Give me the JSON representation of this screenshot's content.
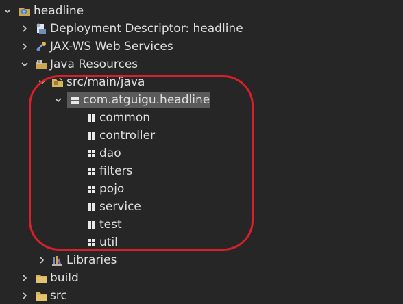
{
  "tree": {
    "root": {
      "label": "headline",
      "icon": "project-icon"
    },
    "items": [
      {
        "label": "Deployment Descriptor: headline",
        "icon": "deployment-descriptor-icon"
      },
      {
        "label": "JAX-WS Web Services",
        "icon": "web-services-icon"
      },
      {
        "label": "Java Resources",
        "icon": "java-resources-icon"
      },
      {
        "label": "src/main/java",
        "icon": "source-folder-icon"
      },
      {
        "label": "com.atguigu.headline",
        "icon": "package-icon"
      },
      {
        "label": "common",
        "icon": "package-icon"
      },
      {
        "label": "controller",
        "icon": "package-icon"
      },
      {
        "label": "dao",
        "icon": "package-icon"
      },
      {
        "label": "filters",
        "icon": "package-icon"
      },
      {
        "label": "pojo",
        "icon": "package-icon"
      },
      {
        "label": "service",
        "icon": "package-icon"
      },
      {
        "label": "test",
        "icon": "package-icon"
      },
      {
        "label": "util",
        "icon": "package-icon"
      },
      {
        "label": "Libraries",
        "icon": "libraries-icon"
      },
      {
        "label": "build",
        "icon": "folder-icon"
      },
      {
        "label": "src",
        "icon": "folder-icon"
      }
    ]
  },
  "colors": {
    "background": "#262626",
    "text": "#dedede",
    "selection": "#5a5a5a",
    "annotation": "#d8202c"
  }
}
